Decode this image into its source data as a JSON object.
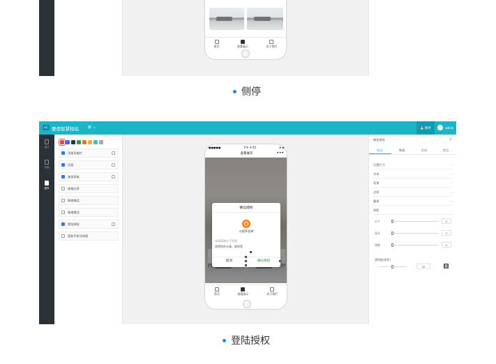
{
  "top_shot": {
    "tabs": [
      "首页",
      "查看展示",
      "关于我们"
    ]
  },
  "captions": {
    "top": "侧停",
    "bottom": "登陆授权"
  },
  "editor": {
    "logo": "KD",
    "title": "壹佰智慧轻站",
    "menu_label": "⊞ ⌄",
    "save_label": "💾 保存",
    "user": "admin",
    "accent_color": "#1bb5c8",
    "rail": [
      "设计",
      "页面",
      "组件"
    ],
    "swatches": [
      "#e34a4a",
      "#3b6fe0",
      "#333333",
      "#2e9d47",
      "#e0743a",
      "#e8b23a",
      "#4fb8c8",
      "#a9a9a9"
    ],
    "features": [
      {
        "label": "顶部导航栏",
        "checked": true
      },
      {
        "label": "页面",
        "checked": true
      },
      {
        "label": "底部导航",
        "checked": true
      },
      {
        "label": "联络分享",
        "checked": false
      },
      {
        "label": "联络电话",
        "checked": false
      },
      {
        "label": "联络电话",
        "checked": false
      },
      {
        "label": "登陆授权",
        "checked": true
      },
      {
        "label": "获取手机号授权",
        "checked": false
      }
    ],
    "phone": {
      "status_left": "●●●●●",
      "status_time": "下午 4:55",
      "status_right": "◔ ▬",
      "nav_title": "查看展示",
      "nav_more": "•••",
      "tabs": [
        "首页",
        "查看展示",
        "关于我们"
      ]
    },
    "dialog": {
      "title": "微信授权",
      "app_name": "小程序名称",
      "request": "申请获取以下权限",
      "permission": "获得您的头像、昵称等",
      "cancel": "取消",
      "confirm": "确认授权"
    },
    "right_panel": {
      "header": "微信授权",
      "close": "×",
      "tabs": [
        "样式",
        "数据",
        "方向",
        "交互"
      ],
      "rows": [
        "位置尺寸",
        "字体",
        "背景",
        "边框",
        "圆角",
        "阴影"
      ],
      "chevron": "›",
      "sliders": [
        {
          "label": "水平",
          "value": "0",
          "level": 0
        },
        {
          "label": "垂直",
          "value": "0",
          "level": 0
        },
        {
          "label": "模糊",
          "value": "0",
          "level": 0
        }
      ],
      "opacity_label": "透明度(颜色)",
      "opacity_value": "30"
    }
  }
}
